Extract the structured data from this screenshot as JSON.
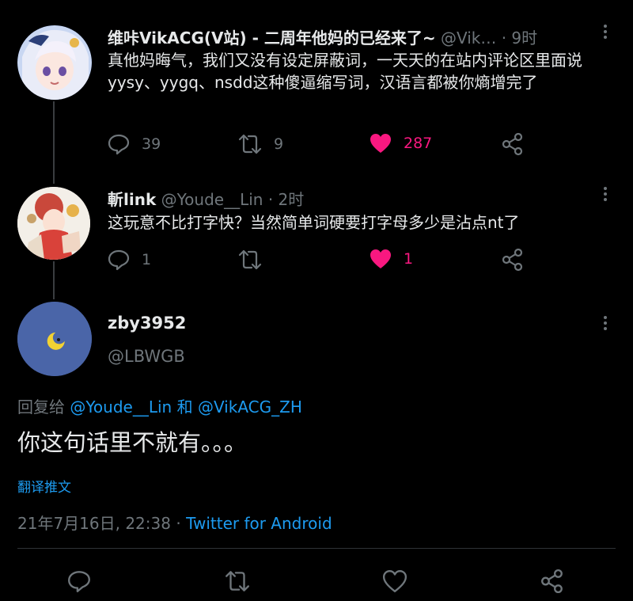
{
  "tweets": [
    {
      "display_name": "维咔VikACG(V站) - 二周年他妈的已经来了~",
      "handle": "@Vik…",
      "time": "· 9时",
      "text": "真他妈晦气，我们又没有设定屏蔽词，一天天的在站内评论区里面说yysy、yygq、nsdd这种傻逼缩写词，汉语言都被你熵增完了",
      "replies": "39",
      "retweets": "9",
      "likes": "287"
    },
    {
      "display_name": "斬link",
      "handle": "@Youde__Lin",
      "time": "· 2时",
      "text": "这玩意不比打字快？当然简单词硬要打字母多少是沾点nt了",
      "replies": "1",
      "likes": "1"
    }
  ],
  "focused": {
    "display_name": "zby3952",
    "handle": "@LBWGB",
    "reply_to_label": "回复给",
    "reply_to_user1": "@Youde__Lin",
    "reply_to_and": "和",
    "reply_to_user2": "@VikACG_ZH",
    "text": "你这句话里不就有。。。",
    "translate": "翻译推文",
    "timestamp": "21年7月16日, 22:38 ·",
    "source": "Twitter for Android"
  },
  "colors": {
    "background": "#000000",
    "accent": "#1d9bf0",
    "like": "#f91880",
    "muted": "#6f767b"
  },
  "icons": [
    "reply-icon",
    "retweet-icon",
    "heart-icon",
    "share-icon",
    "more-icon",
    "moon-icon"
  ]
}
